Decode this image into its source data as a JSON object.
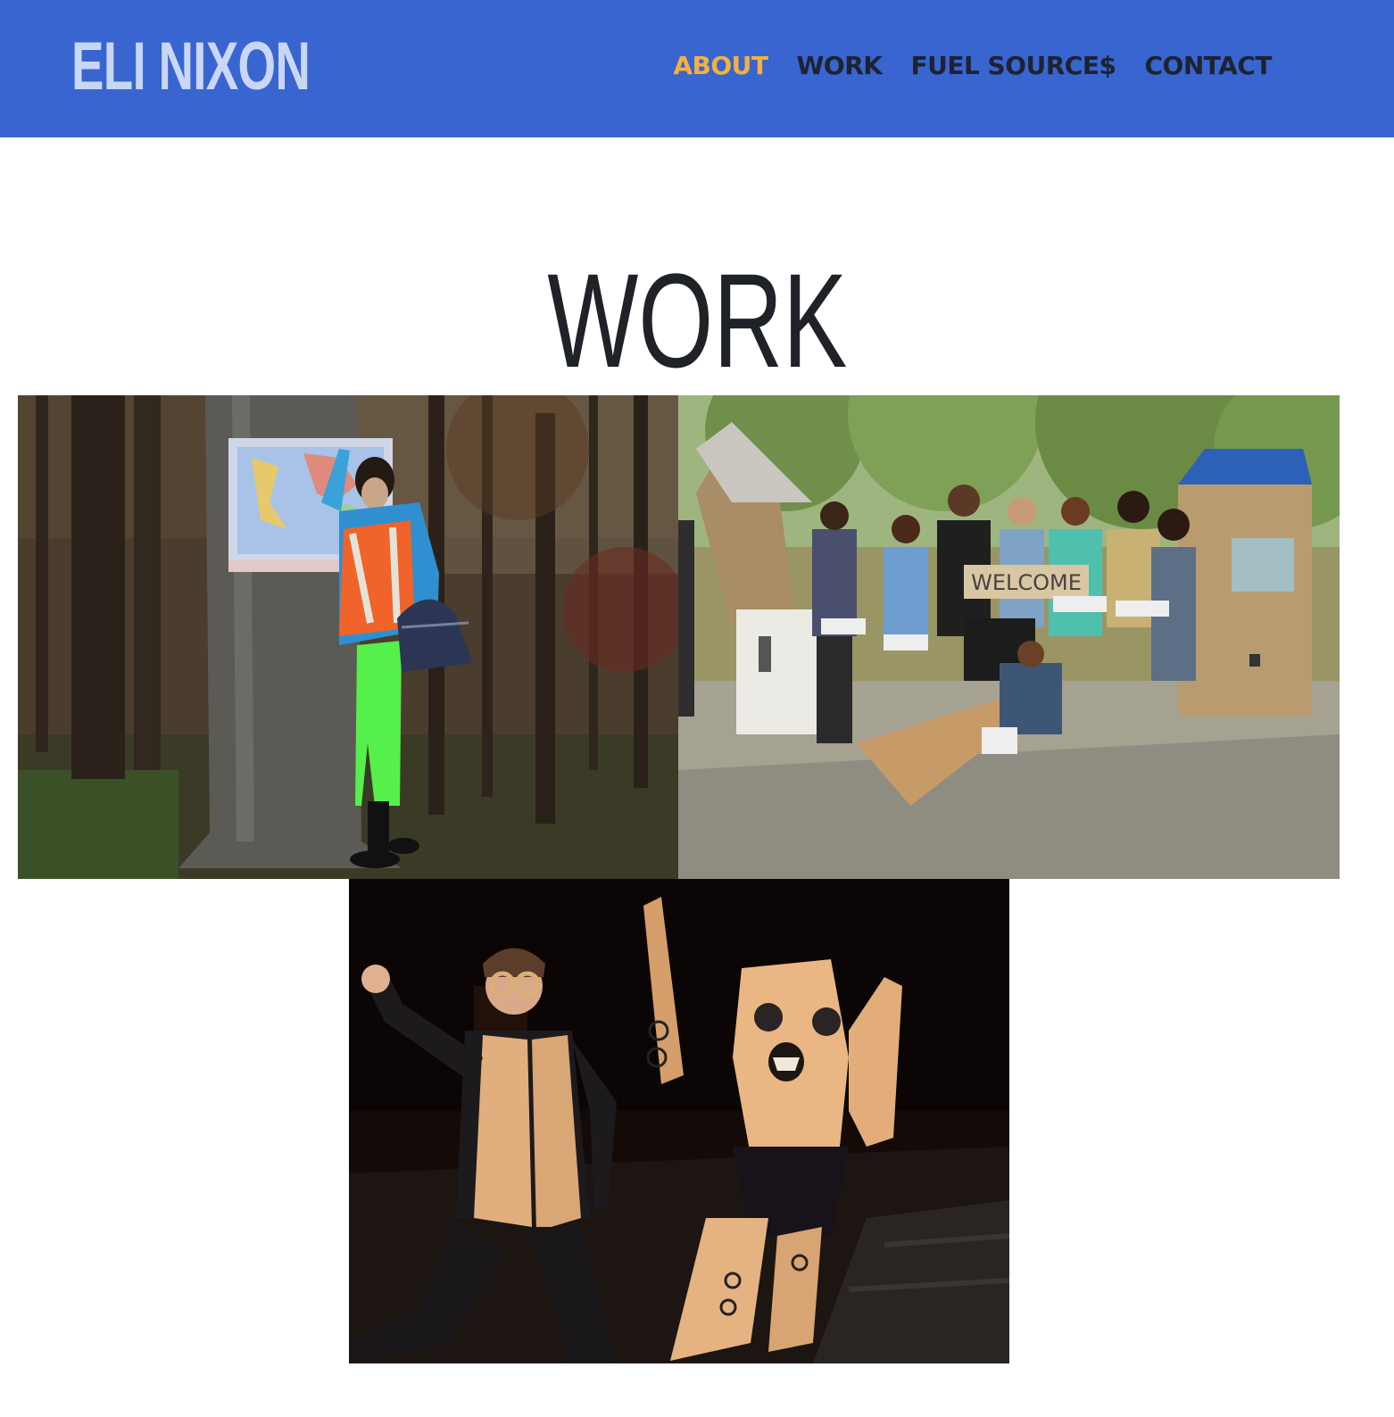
{
  "header": {
    "logo_text": "ELI NIXON",
    "background_color": "#3865d0",
    "logo_color": "#c9d6f5",
    "nav": [
      {
        "label": "ABOUT",
        "active": true,
        "color": "#f4b13c"
      },
      {
        "label": "WORK",
        "active": false,
        "color": "#1f2230"
      },
      {
        "label": "FUEL SOURCE$",
        "active": false,
        "color": "#1f2230"
      },
      {
        "label": "CONTACT",
        "active": false,
        "color": "#1f2230"
      }
    ]
  },
  "main": {
    "title": "WORK",
    "gallery": [
      {
        "subject": "performer in orange safety vest and neon green tights pointing at world map on tree in forest"
      },
      {
        "subject": "group of youth posing with cardboard houses and WELCOME sign in park"
      },
      {
        "subject": "stage performance with person in cardboard vest and cardboard robot costume"
      }
    ]
  }
}
